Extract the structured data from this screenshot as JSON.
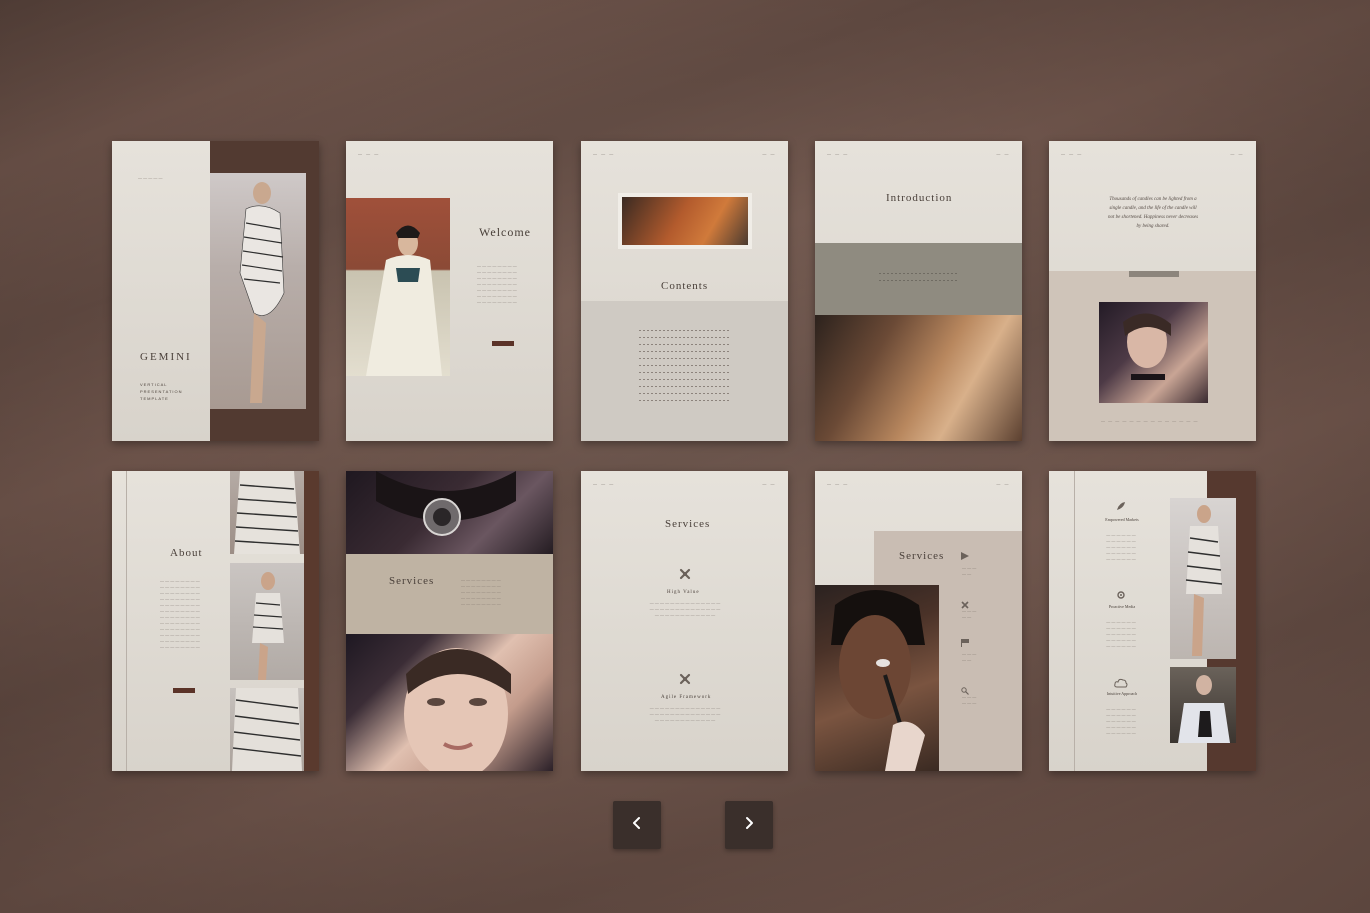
{
  "slides": {
    "cover": {
      "brand": "Gemini",
      "subtitle_1": "Vertical",
      "subtitle_2": "Presentation",
      "subtitle_3": "Template"
    },
    "welcome": {
      "title": "Welcome"
    },
    "contents": {
      "title": "Contents"
    },
    "introduction": {
      "title": "Introduction"
    },
    "quote": {
      "text": "Thousands of candles can be lighted from a single candle, and the life of the candle will not be shortened. Happiness never decreases by being shared."
    },
    "about": {
      "title": "About"
    },
    "services_a": {
      "title": "Services"
    },
    "services_b": {
      "title": "Services",
      "item_1": "High Value",
      "item_2": "Agile Framework"
    },
    "services_c": {
      "title": "Services"
    },
    "features": {
      "item_1": "Empowered Markets",
      "item_2": "Proactive Media",
      "item_3": "Intuitive Approach"
    }
  },
  "colors": {
    "background": "#6d554b",
    "page": "#e0dcd5",
    "accent": "#5b3328",
    "nav_button": "#3a2f2b"
  },
  "navigation": {
    "prev_icon": "chevron-left-icon",
    "next_icon": "chevron-right-icon"
  }
}
